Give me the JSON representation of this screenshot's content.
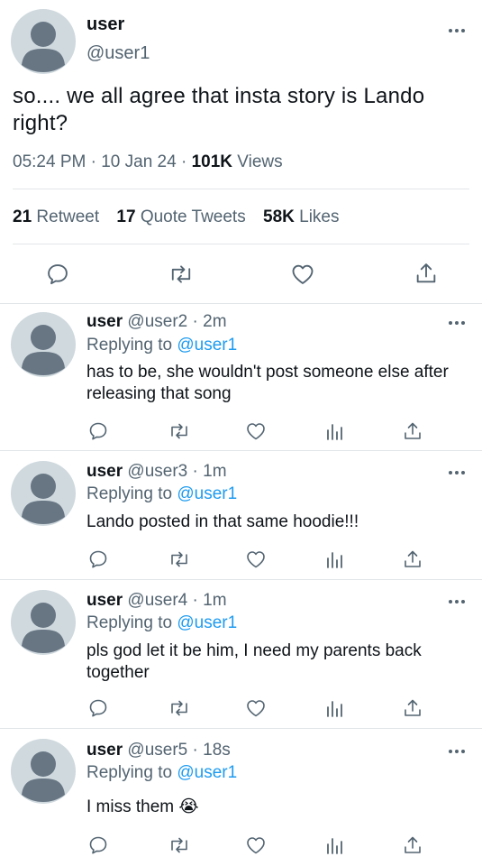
{
  "main": {
    "name": "user",
    "handle": "@user1",
    "text": "so.... we all agree that insta story is Lando right?",
    "time": "05:24 PM",
    "date": "10 Jan 24",
    "views_count": "101K",
    "views_label": "Views",
    "retweets_count": "21",
    "retweets_label": "Retweet",
    "quotes_count": "17",
    "quotes_label": "Quote Tweets",
    "likes_count": "58K",
    "likes_label": "Likes",
    "icons": [
      "comment-icon",
      "retweet-icon",
      "heart-icon",
      "share-icon"
    ]
  },
  "replying_prefix": "Replying to",
  "replies": [
    {
      "name": "user",
      "handle": "@user2",
      "time": "2m",
      "replying_to": "@user1",
      "text": "has to be, she wouldn't post someone else after releasing that song"
    },
    {
      "name": "user",
      "handle": "@user3",
      "time": "1m",
      "replying_to": "@user1",
      "text": "Lando posted in that same hoodie!!!"
    },
    {
      "name": "user",
      "handle": "@user4",
      "time": "1m",
      "replying_to": "@user1",
      "text": "pls god let it be him, I need my parents back together"
    },
    {
      "name": "user",
      "handle": "@user5",
      "time": "18s",
      "replying_to": "@user1",
      "text": "I miss them 😭"
    }
  ],
  "reply_icons": [
    "comment-icon",
    "retweet-icon",
    "heart-icon",
    "analytics-icon",
    "share-icon"
  ],
  "colors": {
    "text": "#0f1419",
    "secondary": "#536471",
    "mention": "#1d9bf0",
    "icon": "#536471",
    "divider": "#e1e5e8",
    "avatar_bg": "#cfd9de",
    "avatar_fg": "#687684"
  }
}
